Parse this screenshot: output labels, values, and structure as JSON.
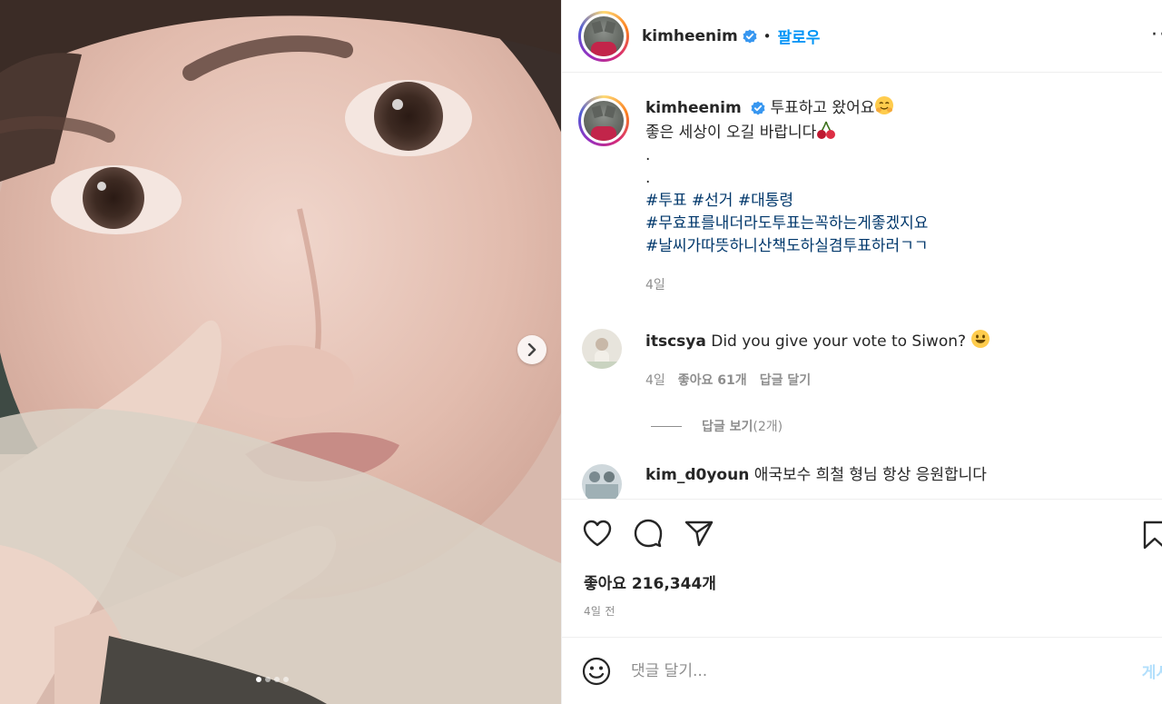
{
  "media": {
    "slide_count": 4,
    "active_slide": 1
  },
  "header": {
    "username": "kimheenim",
    "separator": "•",
    "follow_label": "팔로우",
    "more_label": "··"
  },
  "caption": {
    "username": "kimheenim",
    "line1": "투표하고 왔어요",
    "line2": "좋은 세상이 오길 바랍니다",
    "dot1": ".",
    "dot2": ".",
    "hashtag1": "#투표 #선거 #대통령",
    "hashtag2": "#무효표를내더라도투표는꼭하는게좋겠지요",
    "hashtag3": "#날씨가따뜻하니산책도하실겸투표하러ㄱㄱ",
    "time": "4일"
  },
  "comments": [
    {
      "username": "itscsya",
      "text": "Did you give your vote to Siwon?",
      "time": "4일",
      "likes": "좋아요 61개",
      "reply_label": "답글 달기"
    },
    {
      "username": "kim_d0youn",
      "text": "애국보수 희철 형님 항상 응원합니다"
    }
  ],
  "view_replies": {
    "label": "답글 보기",
    "count": "(2개)"
  },
  "actions": {
    "likes": "좋아요 216,344개",
    "time": "4일 전"
  },
  "add_comment": {
    "placeholder": "댓글 달기...",
    "post_label": "게시"
  },
  "colors": {
    "accent": "#0095f6",
    "hashtag": "#00376b",
    "muted": "#8e8e8e",
    "post_disabled": "#b2dffc"
  }
}
